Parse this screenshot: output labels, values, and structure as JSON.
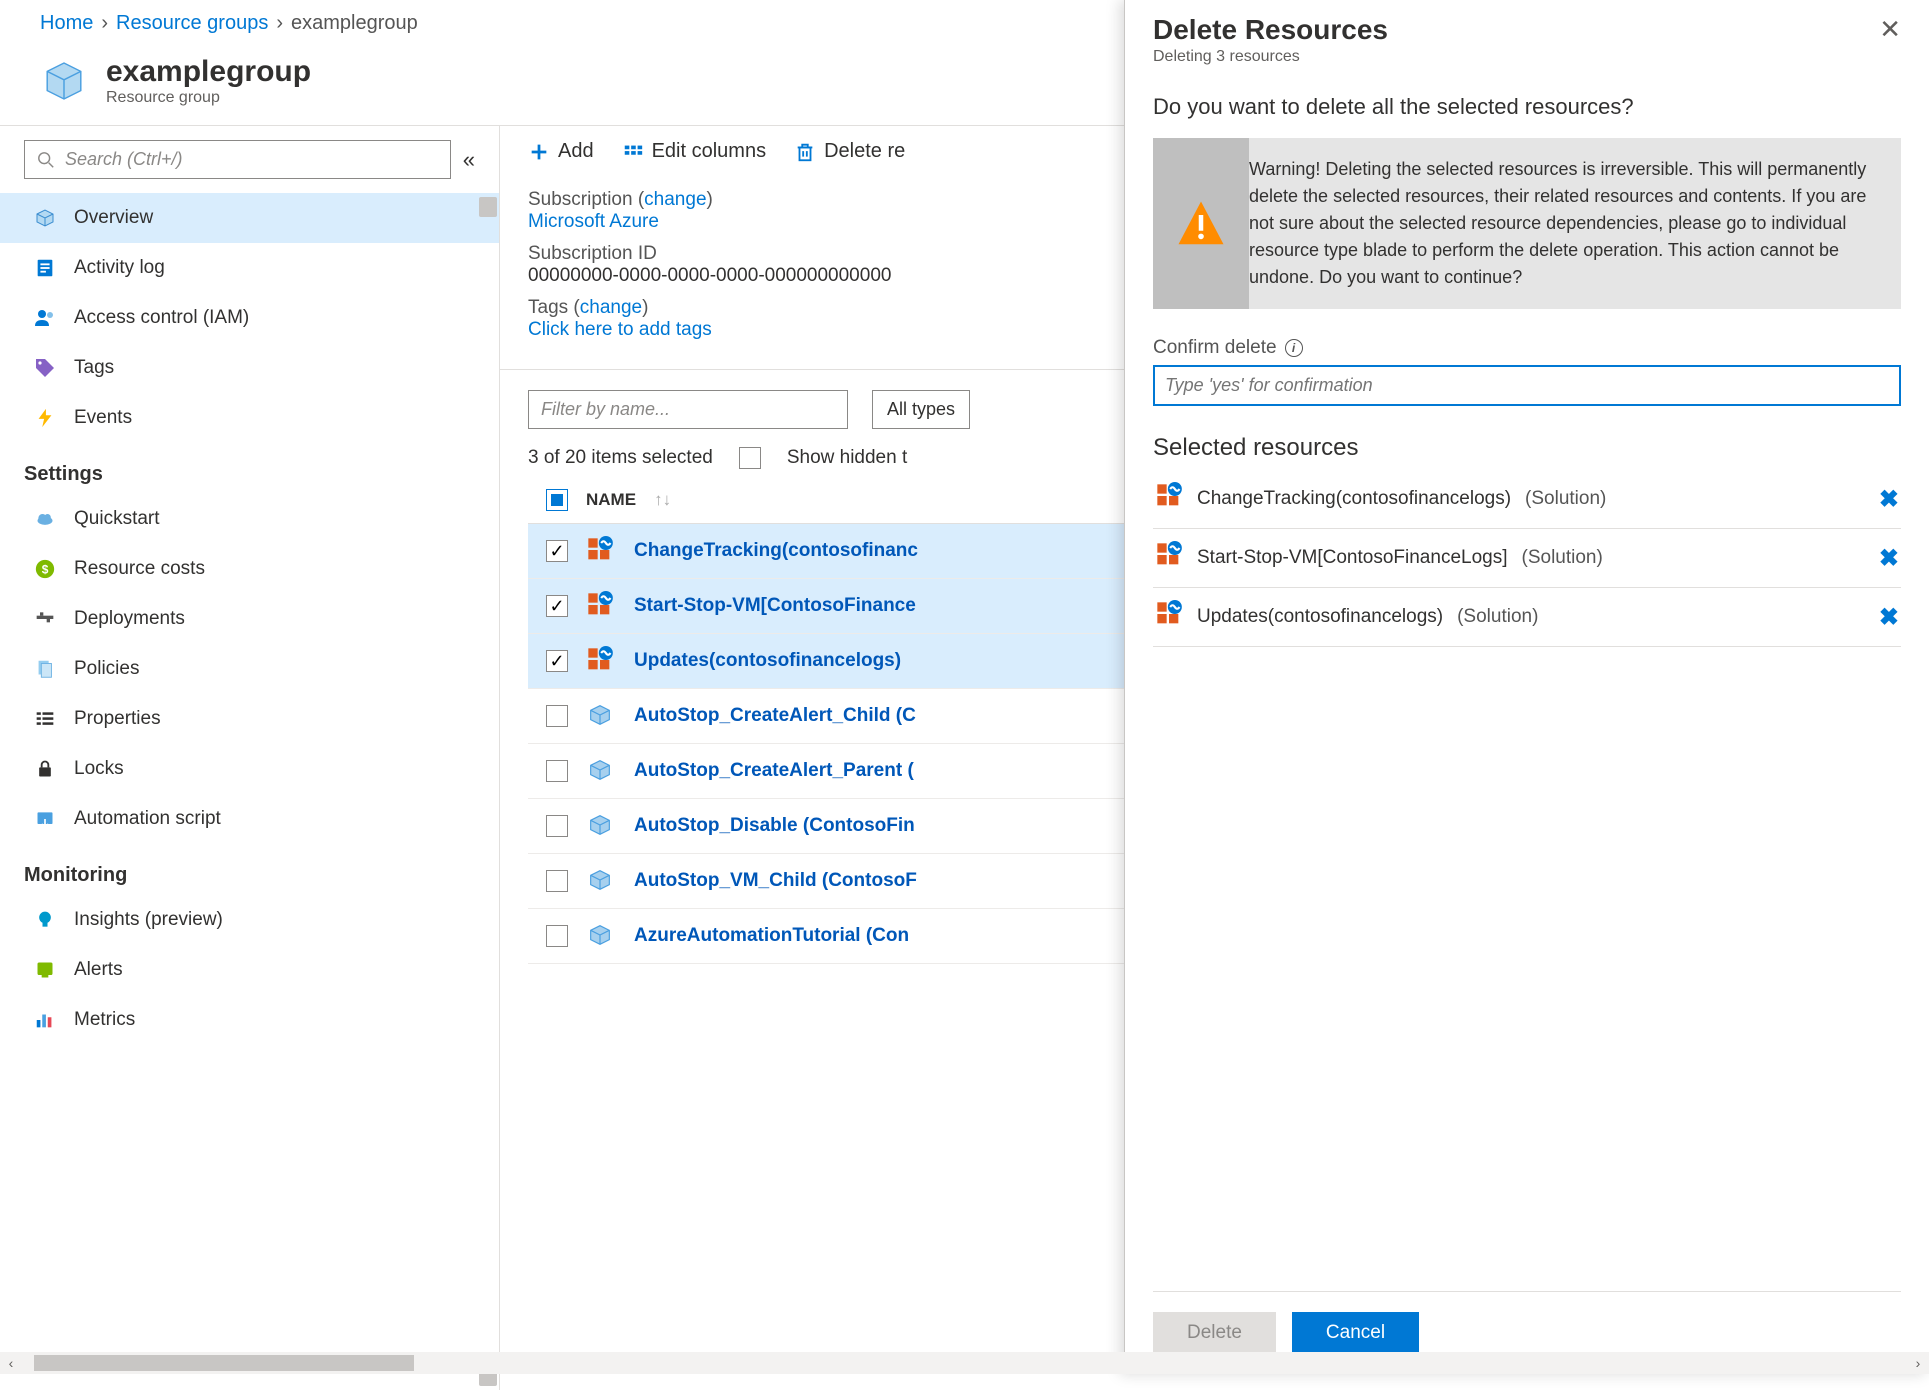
{
  "breadcrumb": {
    "home": "Home",
    "rg": "Resource groups",
    "current": "examplegroup"
  },
  "header": {
    "title": "examplegroup",
    "subtitle": "Resource group"
  },
  "search": {
    "placeholder": "Search (Ctrl+/)"
  },
  "nav": {
    "items": [
      {
        "label": "Overview",
        "icon": "cube-icon",
        "active": true
      },
      {
        "label": "Activity log",
        "icon": "log-icon"
      },
      {
        "label": "Access control (IAM)",
        "icon": "people-icon"
      },
      {
        "label": "Tags",
        "icon": "tag-icon"
      },
      {
        "label": "Events",
        "icon": "bolt-icon"
      }
    ],
    "section_settings": "Settings",
    "settings": [
      {
        "label": "Quickstart",
        "icon": "cloud-icon"
      },
      {
        "label": "Resource costs",
        "icon": "cost-icon"
      },
      {
        "label": "Deployments",
        "icon": "deploy-icon"
      },
      {
        "label": "Policies",
        "icon": "policy-icon"
      },
      {
        "label": "Properties",
        "icon": "properties-icon"
      },
      {
        "label": "Locks",
        "icon": "lock-icon"
      },
      {
        "label": "Automation script",
        "icon": "script-icon"
      }
    ],
    "section_monitoring": "Monitoring",
    "monitoring": [
      {
        "label": "Insights (preview)",
        "icon": "bulb-icon"
      },
      {
        "label": "Alerts",
        "icon": "alert-icon"
      },
      {
        "label": "Metrics",
        "icon": "metrics-icon"
      }
    ]
  },
  "toolbar": {
    "add": "Add",
    "edit_columns": "Edit columns",
    "delete": "Delete re"
  },
  "detail": {
    "sub_label": "Subscription (",
    "sub_change": "change",
    "sub_label_end": ")",
    "sub_value": "Microsoft Azure",
    "subid_label": "Subscription ID",
    "subid_value": "00000000-0000-0000-0000-000000000000",
    "tags_label": "Tags (",
    "tags_change": "change",
    "tags_label_end": ")",
    "tags_link": "Click here to add tags"
  },
  "grid": {
    "filter_placeholder": "Filter by name...",
    "types": "All types",
    "count": "3 of 20 items selected",
    "show_hidden": "Show hidden t",
    "col_name": "NAME",
    "rows": [
      {
        "name": "ChangeTracking(contosofinanc",
        "selected": true,
        "type": "solution"
      },
      {
        "name": "Start-Stop-VM[ContosoFinance",
        "selected": true,
        "type": "solution"
      },
      {
        "name": "Updates(contosofinancelogs)",
        "selected": true,
        "type": "solution"
      },
      {
        "name": "AutoStop_CreateAlert_Child (C",
        "selected": false,
        "type": "runbook"
      },
      {
        "name": "AutoStop_CreateAlert_Parent (",
        "selected": false,
        "type": "runbook"
      },
      {
        "name": "AutoStop_Disable (ContosoFin",
        "selected": false,
        "type": "runbook"
      },
      {
        "name": "AutoStop_VM_Child (ContosoF",
        "selected": false,
        "type": "runbook"
      },
      {
        "name": "AzureAutomationTutorial (Con",
        "selected": false,
        "type": "runbook"
      }
    ]
  },
  "panel": {
    "title": "Delete Resources",
    "subtitle": "Deleting 3 resources",
    "question": "Do you want to delete all the selected resources?",
    "warning": "Warning! Deleting the selected resources is irreversible. This will permanently delete the selected resources, their related resources and contents. If you are not sure about the selected resource dependencies, please go to individual resource type blade to perform the delete operation. This action cannot be undone. Do you want to continue?",
    "confirm_label": "Confirm delete",
    "confirm_placeholder": "Type 'yes' for confirmation",
    "selected_title": "Selected resources",
    "selected": [
      {
        "name": "ChangeTracking(contosofinancelogs)",
        "type": "(Solution)"
      },
      {
        "name": "Start-Stop-VM[ContosoFinanceLogs]",
        "type": "(Solution)"
      },
      {
        "name": "Updates(contosofinancelogs)",
        "type": "(Solution)"
      }
    ],
    "delete_btn": "Delete",
    "cancel_btn": "Cancel"
  }
}
